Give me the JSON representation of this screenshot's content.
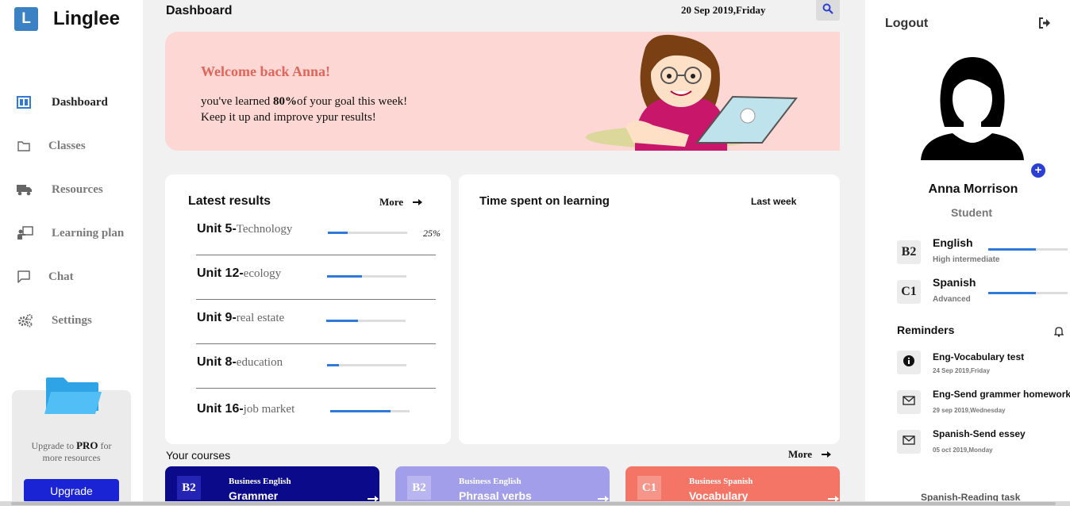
{
  "app": {
    "logo_letter": "L",
    "name": "Linglee"
  },
  "sidebar": {
    "items": [
      {
        "label": "Dashboard",
        "icon": "dashboard-icon",
        "active": true
      },
      {
        "label": "Classes",
        "icon": "folder-icon"
      },
      {
        "label": "Resources",
        "icon": "truck-icon"
      },
      {
        "label": "Learning plan",
        "icon": "teacher-board-icon"
      },
      {
        "label": "Chat",
        "icon": "chat-icon"
      },
      {
        "label": "Settings",
        "icon": "gears-icon"
      }
    ],
    "upgrade": {
      "text_before": "Upgrade to ",
      "pro": "PRO",
      "text_after": " for",
      "text_line2": "more resources",
      "button": "Upgrade"
    }
  },
  "header": {
    "title": "Dashboard",
    "date": "20 Sep 2019,Friday",
    "search_icon": "search-icon"
  },
  "banner": {
    "welcome": "Welcome back Anna!",
    "line1_prefix": "you've learned ",
    "line1_value": "80%",
    "line1_suffix": "of your goal this week!",
    "line2": "Keep it up and improve ypur results!"
  },
  "latest_results": {
    "title": "Latest results",
    "more": "More",
    "rows": [
      {
        "unit": "Unit 5-",
        "topic": "Technology",
        "progress": 0.25,
        "percent": "25%"
      },
      {
        "unit": "Unit 12-",
        "topic": "ecology",
        "progress": 0.44
      },
      {
        "unit": "Unit 9-",
        "topic": "real estate",
        "progress": 0.4
      },
      {
        "unit": "Unit 8-",
        "topic": "education",
        "progress": 0.15
      },
      {
        "unit": "Unit 16-",
        "topic": "job market",
        "progress": 0.76
      }
    ]
  },
  "time_spent": {
    "title": "Time spent on learning",
    "period": "Last week"
  },
  "courses": {
    "title": "Your courses",
    "more": "More",
    "items": [
      {
        "level": "B2",
        "category": "Business English",
        "name": "Grammer",
        "color": "#0a0a8a",
        "badge_color": "#2525b5"
      },
      {
        "level": "B2",
        "category": "Business English",
        "name": "Phrasal verbs",
        "color": "#a29ee9",
        "badge_color": "#b9b5f0"
      },
      {
        "level": "C1",
        "category": "Business Spanish",
        "name": "Vocabulary",
        "color": "#f47565",
        "badge_color": "#f6958a"
      }
    ]
  },
  "profile": {
    "logout": "Logout",
    "name": "Anna Morrison",
    "role": "Student",
    "languages": [
      {
        "level": "B2",
        "name": "English",
        "description": "High intermediate",
        "progress": 0.6
      },
      {
        "level": "C1",
        "name": "Spanish",
        "description": "Advanced",
        "progress": 0.6
      }
    ]
  },
  "reminders": {
    "title": "Reminders",
    "items": [
      {
        "icon": "info-icon",
        "title": "Eng-Vocabulary test",
        "date": "24 Sep 2019,Friday"
      },
      {
        "icon": "mail-icon",
        "title": "Eng-Send grammer homework",
        "date": "29 sep 2019,Wednesday"
      },
      {
        "icon": "mail-icon",
        "title": "Spanish-Send essey",
        "date": "05 oct 2019,Monday"
      },
      {
        "icon": "mail-icon",
        "title": "Spanish-Reading task"
      }
    ]
  },
  "colors": {
    "accent": "#2f7ad8",
    "banner_bg": "#fdd7d3",
    "welcome": "#e0665c",
    "upgrade": "#1a24d4"
  }
}
